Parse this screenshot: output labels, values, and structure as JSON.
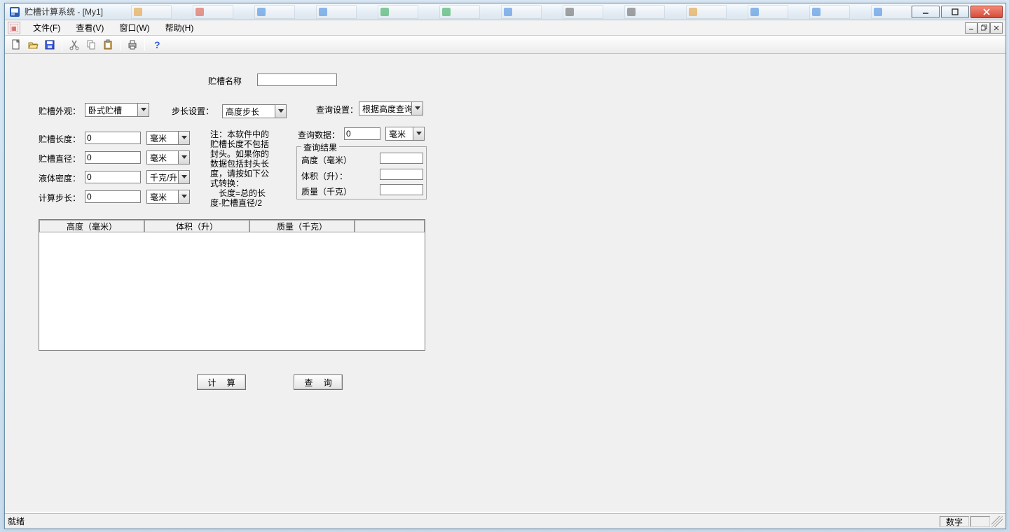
{
  "window": {
    "title": "贮槽计算系统 - [My1]"
  },
  "menu": {
    "file": "文件(F)",
    "view": "查看(V)",
    "window": "窗口(W)",
    "help": "帮助(H)"
  },
  "toolbarIcons": {
    "new": "new-icon",
    "open": "open-icon",
    "save": "save-icon",
    "cut": "cut-icon",
    "copy": "copy-icon",
    "paste": "paste-icon",
    "print": "print-icon",
    "help": "help-icon"
  },
  "form": {
    "nameLabel": "贮槽名称",
    "nameValue": "",
    "appearanceLabel": "贮槽外观：",
    "appearanceValue": "卧式贮槽",
    "stepSettingLabel": "步长设置：",
    "stepSettingValue": "高度步长",
    "querySettingLabel": "查询设置：",
    "querySettingValue": "根据高度查询",
    "lengthLabel": "贮槽长度：",
    "lengthValue": "0",
    "lengthUnit": "毫米",
    "diameterLabel": "贮槽直径：",
    "diameterValue": "0",
    "diameterUnit": "毫米",
    "densityLabel": "液体密度：",
    "densityValue": "0",
    "densityUnit": "千克/升",
    "calcStepLabel": "计算步长：",
    "calcStepValue": "0",
    "calcStepUnit": "毫米",
    "note": "注：本软件中的贮槽长度不包括封头。如果你的数据包括封头长度，请按如下公式转换：\n　长度=总的长度-贮槽直径/2",
    "queryDataLabel": "查询数据：",
    "queryDataValue": "0",
    "queryDataUnit": "毫米",
    "resultGroup": "查询结果",
    "resHeightLabel": "高度（毫米）",
    "resVolumeLabel": "体积（升）：",
    "resMassLabel": "质量（千克）",
    "tableHeaders": {
      "h1": "高度（毫米）",
      "h2": "体积（升）",
      "h3": "质量（千克）"
    },
    "calcBtn": "计 算",
    "queryBtn": "查 询"
  },
  "status": {
    "ready": "就绪",
    "num": "数字"
  },
  "winControls": {
    "min": "–",
    "max": "☐",
    "close": "✕"
  },
  "colors": {
    "titlebar": "#e6eef6",
    "client": "#f0f0f0",
    "closeBtn": "#d54b36"
  }
}
